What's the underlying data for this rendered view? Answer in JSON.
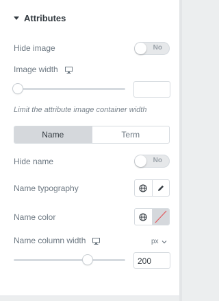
{
  "section": {
    "title": "Attributes"
  },
  "hide_image": {
    "label": "Hide image",
    "toggle_text": "No",
    "checked": false
  },
  "image_width": {
    "label": "Image width",
    "value": "",
    "slider_fraction": 0.0
  },
  "hint": "Limit the attribute image container width",
  "tabs": [
    {
      "label": "Name",
      "active": true
    },
    {
      "label": "Term",
      "active": false
    }
  ],
  "hide_name": {
    "label": "Hide name",
    "toggle_text": "No",
    "checked": false
  },
  "name_typography": {
    "label": "Name typography"
  },
  "name_color": {
    "label": "Name color"
  },
  "name_column_width": {
    "label": "Name column width",
    "unit": "px",
    "value": "200",
    "slider_fraction": 0.66
  },
  "colors": {
    "accent_track": "#d5dadf",
    "active_tab": "#d5d8dc"
  }
}
